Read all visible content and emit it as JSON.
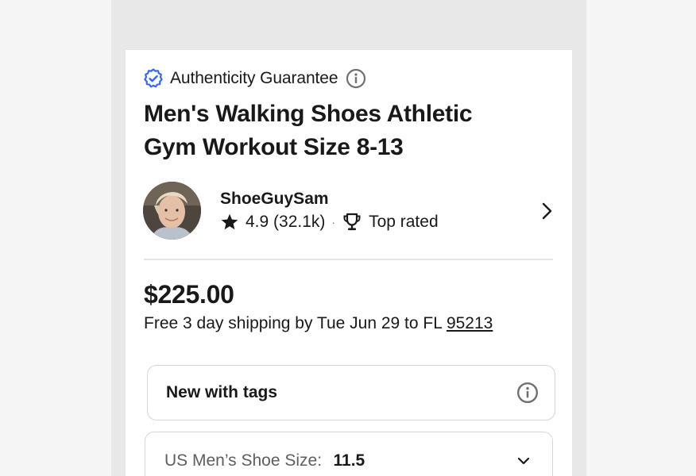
{
  "listing": {
    "authenticity_label": "Authenticity Guarantee",
    "title": "Men's Walking Shoes Athletic Gym Workout Size 8-13",
    "seller": {
      "name": "ShoeGuySam",
      "rating": "4.9 (32.1k)",
      "separator": "·",
      "badge": "Top rated"
    },
    "price": "$225.00",
    "shipping": {
      "text": "Free 3 day shipping by Tue Jun 29 to FL ",
      "zip": "95213"
    },
    "condition": {
      "label": "New with tags"
    },
    "size": {
      "label": "US Men’s Shoe Size:",
      "value": "11.5"
    }
  },
  "colors": {
    "badge_blue": "#3665f3",
    "text": "#191919",
    "muted": "#707070",
    "border": "#d6d6d6"
  },
  "icons": [
    "verified-badge-icon",
    "info-icon",
    "star-icon",
    "trophy-icon",
    "chevron-right-icon",
    "chevron-down-icon"
  ]
}
